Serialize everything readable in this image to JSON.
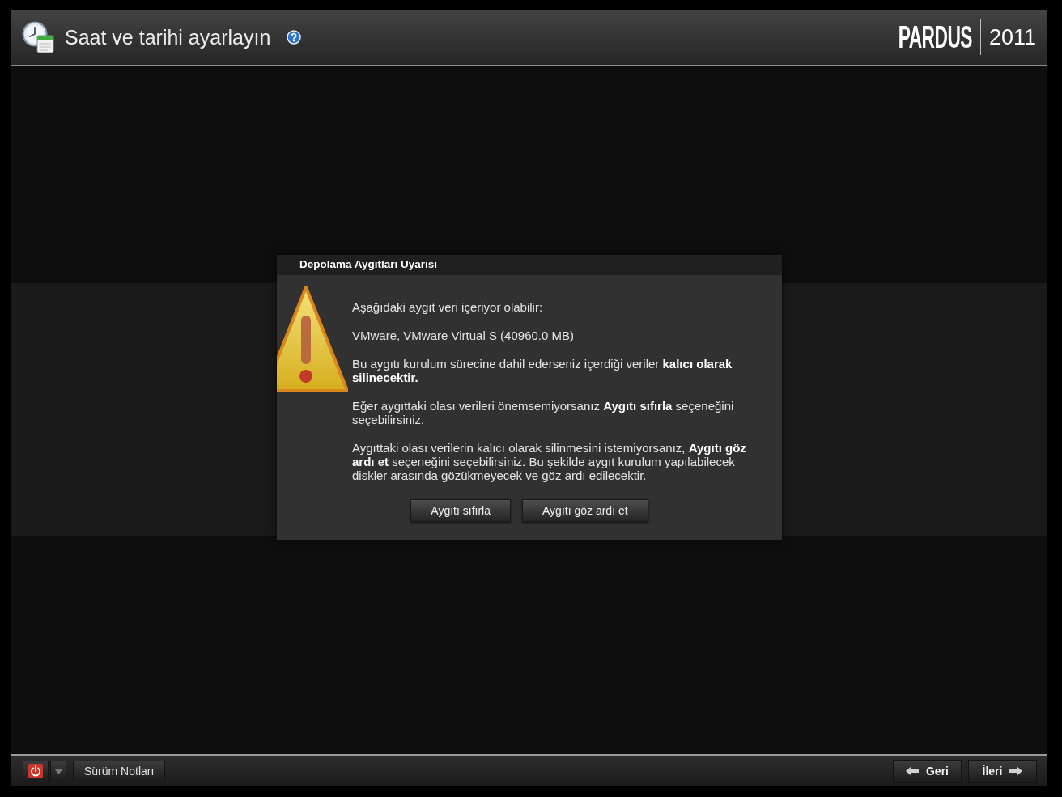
{
  "header": {
    "title": "Saat ve tarihi ayarlayın",
    "logo": {
      "brand": "PARDUS",
      "version": "2011"
    }
  },
  "dialog": {
    "title": "Depolama Aygıtları Uyarısı",
    "paragraphs": [
      "Aşağıdaki aygıt veri içeriyor olabilir:",
      "VMware, VMware Virtual S (40960.0 MB)",
      "Bu aygıtı kurulum sürecine dahil ederseniz içerdiği veriler **kalıcı olarak silinecektir.**",
      "Eğer aygıttaki olası verileri önemsemiyorsanız **Aygıtı sıfırla** seçeneğini seçebilirsiniz.",
      "Aygıttaki olası verilerin kalıcı olarak silinmesini istemiyorsanız, **Aygıtı göz ardı et** seçeneğini seçebilirsiniz. Bu şekilde aygıt kurulum yapılabilecek diskler arasında gözükmeyecek ve göz ardı edilecektir."
    ],
    "buttons": [
      {
        "label": "Aygıtı sıfırla"
      },
      {
        "label": "Aygıtı göz ardı et"
      }
    ]
  },
  "footer": {
    "release_notes": "Sürüm Notları",
    "nav_buttons": [
      {
        "kind": "back",
        "label": "Geri"
      },
      {
        "kind": "next",
        "label": "İleri"
      }
    ]
  }
}
